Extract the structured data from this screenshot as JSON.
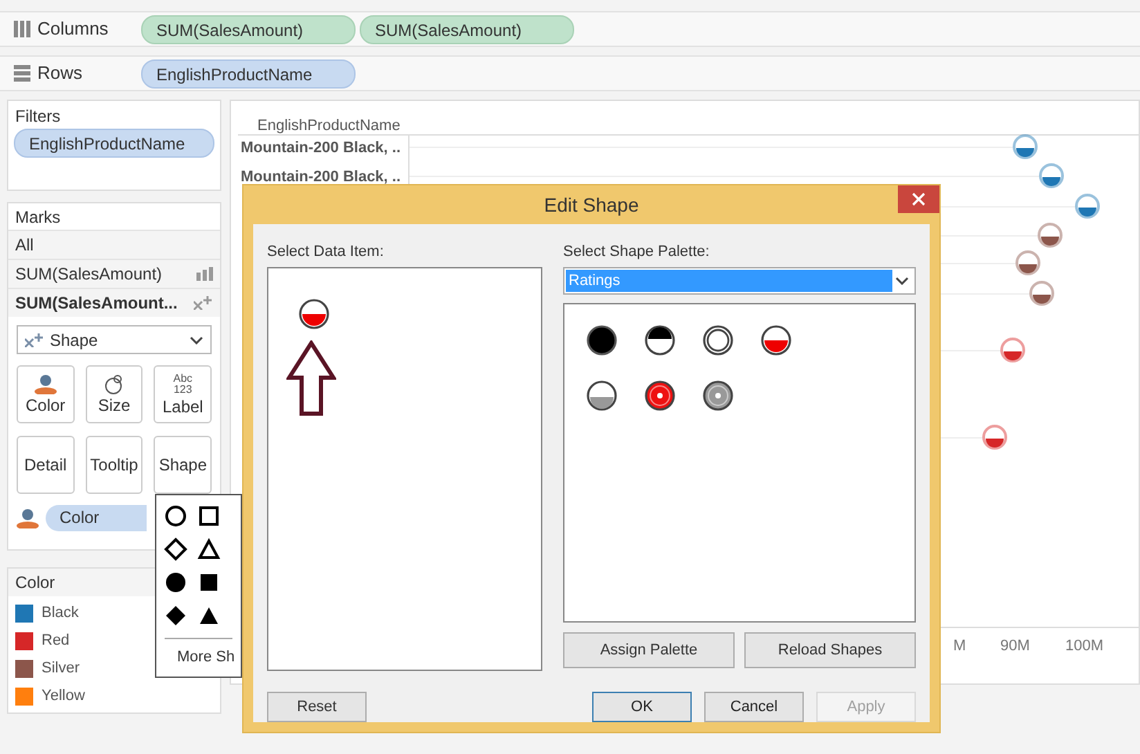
{
  "shelves": [
    {
      "kind": "columns",
      "label": "Columns",
      "pills": [
        "SUM(SalesAmount)",
        "SUM(SalesAmount)"
      ]
    },
    {
      "kind": "rows",
      "label": "Rows",
      "pills": [
        "EnglishProductName"
      ]
    }
  ],
  "filters": {
    "title": "Filters",
    "pills": [
      "EnglishProductName"
    ]
  },
  "marks": {
    "title": "Marks",
    "items": [
      {
        "label": "All",
        "kind": "none",
        "selected": false
      },
      {
        "label": "SUM(SalesAmount)",
        "kind": "bar",
        "selected": false
      },
      {
        "label": "SUM(SalesAmount...",
        "kind": "shape",
        "selected": true
      }
    ],
    "mark_type": "Shape",
    "buttons": [
      {
        "label": "Color",
        "kind": "color"
      },
      {
        "label": "Size",
        "kind": "size"
      },
      {
        "label": "Label",
        "kind": "label",
        "icon_text": [
          "Abc",
          "123"
        ]
      },
      {
        "label": "Detail",
        "kind": "plain"
      },
      {
        "label": "Tooltip",
        "kind": "plain"
      },
      {
        "label": "Shape",
        "kind": "plain"
      }
    ],
    "color_pill": "Color"
  },
  "shape_menu": {
    "shapes": [
      {
        "kind": "circle"
      },
      {
        "kind": "square"
      },
      {
        "kind": "diamond"
      },
      {
        "kind": "triangle"
      },
      {
        "kind": "filled-circle"
      },
      {
        "kind": "filled-square"
      },
      {
        "kind": "filled-diamond"
      },
      {
        "kind": "filled-triangle"
      }
    ],
    "more": "More Sh"
  },
  "legend": {
    "title": "Color",
    "items": [
      {
        "label": "Black",
        "color": "#1f77b4"
      },
      {
        "label": "Red",
        "color": "#d62728"
      },
      {
        "label": "Silver",
        "color": "#8c564b"
      },
      {
        "label": "Yellow",
        "color": "#ff7f0e"
      }
    ]
  },
  "view": {
    "header": "EnglishProductName",
    "rows": [
      "Mountain-200 Black, ..",
      "Mountain-200 Black, .."
    ],
    "points": [
      {
        "color": "#1f77b4"
      },
      {
        "color": "#1f77b4"
      },
      {
        "color": "#1f77b4"
      },
      {
        "color": "#8c564b"
      },
      {
        "color": "#8c564b"
      },
      {
        "color": "#8c564b"
      },
      {
        "color": "#d62728"
      },
      {
        "color": "#d62728"
      }
    ],
    "ticks": [
      "M",
      "90M",
      "100M"
    ]
  },
  "dialog": {
    "title": "Edit Shape",
    "data_label": "Select Data Item:",
    "data_items": [
      {
        "kind": "half-red"
      }
    ],
    "palette_label": "Select Shape Palette:",
    "palette": "Ratings",
    "shapes": [
      {
        "kind": "filled"
      },
      {
        "kind": "half-top"
      },
      {
        "kind": "ring"
      },
      {
        "kind": "half-red"
      },
      {
        "kind": "half-gray"
      },
      {
        "kind": "red-dot"
      },
      {
        "kind": "gray-dot"
      }
    ],
    "palette_buttons": [
      "Assign Palette",
      "Reload Shapes"
    ],
    "reset": "Reset",
    "buttons": [
      {
        "label": "OK",
        "kind": "default",
        "disabled": false
      },
      {
        "label": "Cancel",
        "kind": "normal",
        "disabled": false
      },
      {
        "label": "Apply",
        "kind": "normal",
        "disabled": true
      }
    ]
  }
}
